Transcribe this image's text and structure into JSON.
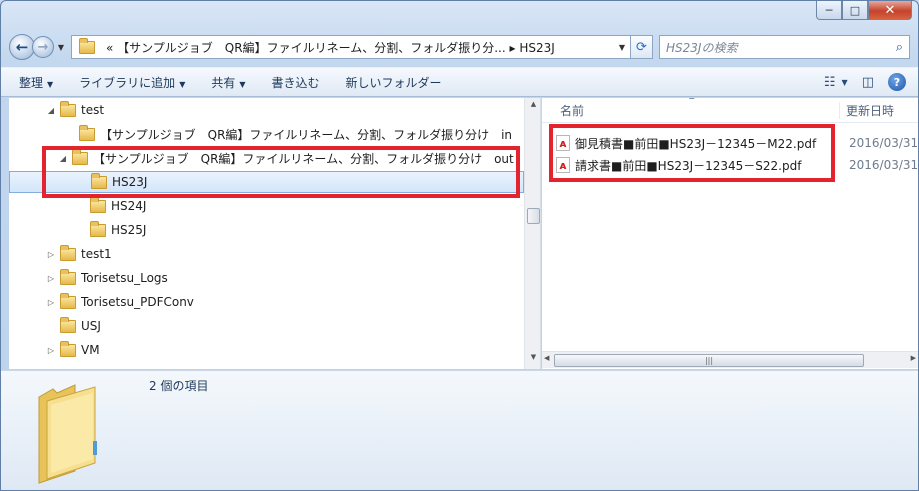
{
  "window": {
    "caption": {
      "minimize": "─",
      "maximize": "□",
      "close": "✕"
    }
  },
  "nav": {
    "back_icon": "arrow-left-icon",
    "forward_icon": "arrow-right-icon",
    "address_path": "«  【サンプルジョブ　QR編】ファイルリネーム、分割、フォルダ振り分...  ▸ HS23J",
    "search_placeholder": "HS23Jの検索"
  },
  "toolbar": {
    "organize": "整理",
    "add_to_library": "ライブラリに追加",
    "share": "共有",
    "burn": "書き込む",
    "new_folder": "新しいフォルダー"
  },
  "tree": [
    {
      "label": "test",
      "expander": "◢"
    },
    {
      "label": "【サンプルジョブ　QR編】ファイルリネーム、分割、フォルダ振り分け　in",
      "expander": ""
    },
    {
      "label": "【サンプルジョブ　QR編】ファイルリネーム、分割、フォルダ振り分け　out",
      "expander": "◢"
    },
    {
      "label": "HS23J",
      "expander": ""
    },
    {
      "label": "HS24J",
      "expander": ""
    },
    {
      "label": "HS25J",
      "expander": ""
    },
    {
      "label": "test1",
      "expander": "▷"
    },
    {
      "label": "Torisetsu_Logs",
      "expander": "▷"
    },
    {
      "label": "Torisetsu_PDFConv",
      "expander": "▷"
    },
    {
      "label": "USJ",
      "expander": ""
    },
    {
      "label": "VM",
      "expander": "▷"
    }
  ],
  "columns": {
    "name": "名前",
    "date": "更新日時"
  },
  "files": [
    {
      "name": "御見積書■前田■HS23J－12345－M22.pdf",
      "date": "2016/03/31"
    },
    {
      "name": "請求書■前田■HS23J－12345－S22.pdf",
      "date": "2016/03/31"
    }
  ],
  "status": {
    "item_count": "2 個の項目"
  },
  "colors": {
    "highlight": "#e3232d",
    "selection": "#d3e6fa"
  }
}
